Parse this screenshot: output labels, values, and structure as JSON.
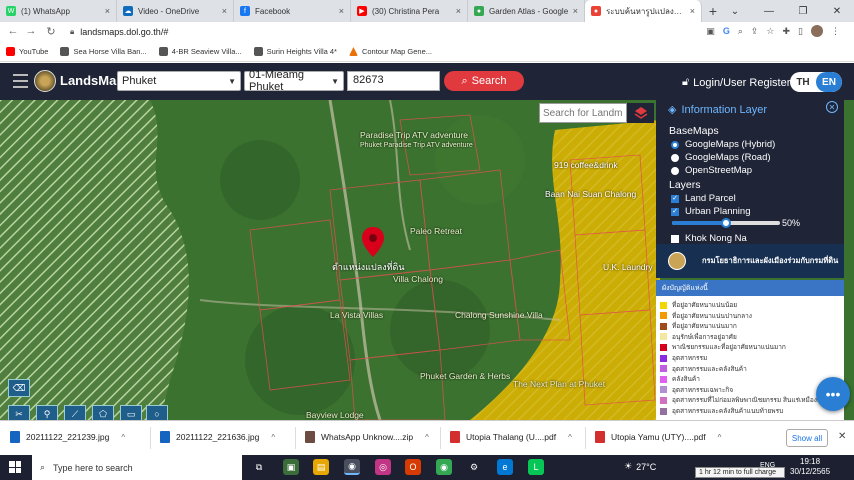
{
  "browser": {
    "tabs": [
      {
        "label": "(1) WhatsApp",
        "color": "#25d366",
        "glyph": "W"
      },
      {
        "label": "Video - OneDrive",
        "color": "#0f6cbd",
        "glyph": "☁"
      },
      {
        "label": "Facebook",
        "color": "#1877f2",
        "glyph": "f"
      },
      {
        "label": "(30) Christina Pera",
        "color": "#ff0000",
        "glyph": "▶"
      },
      {
        "label": "Garden Atlas - Google",
        "color": "#34a853",
        "glyph": "●"
      },
      {
        "label": "ระบบค้นหารูปแปลงที่ดิน",
        "color": "#ea4335",
        "glyph": "●"
      }
    ],
    "url": "landsmaps.dol.go.th/#",
    "bookmarks": [
      {
        "label": "YouTube",
        "color": "#ff0000"
      },
      {
        "label": "Sea Horse Villa Ban...",
        "color": "#555"
      },
      {
        "label": "4-BR Seaview Villa...",
        "color": "#555"
      },
      {
        "label": "Surin Heights Villa 4*",
        "color": "#555"
      },
      {
        "label": "Contour Map Gene...",
        "color": "#e8710a"
      }
    ]
  },
  "header": {
    "brand": "LandsMaps",
    "province": "Phuket",
    "district": "01-Mieamg Phuket",
    "parcel_no": "82673",
    "search_label": "Search",
    "login_label": "Login/User Register",
    "lang_th": "TH",
    "lang_en": "EN"
  },
  "map": {
    "search_placeholder": "Search for Landm",
    "pin_label": "ตำแหน่งแปลงที่ดิน",
    "labels": [
      "Paradise Trip ATV adventure",
      "Phuket Paradise Trip ATV adventure",
      "919 coffee&drink",
      "Baan Nai Suan Chalong",
      "Paleo Retreat",
      "Villa Chalong",
      "La Vista Villas",
      "Chalong Sunshine Villa",
      "Phuket Garden & Herbs",
      "The Next Plan at Phuket",
      "Bayview Lodge",
      "U.K. Laundry"
    ]
  },
  "info_panel": {
    "title": "Information Layer",
    "basemaps_label": "BaseMaps",
    "basemaps": [
      {
        "label": "GoogleMaps (Hybrid)",
        "selected": true
      },
      {
        "label": "GoogleMaps (Road)",
        "selected": false
      },
      {
        "label": "OpenStreetMap",
        "selected": false
      }
    ],
    "layers_label": "Layers",
    "layers": [
      {
        "label": "Land Parcel",
        "checked": true
      },
      {
        "label": "Urban Planning",
        "checked": true
      },
      {
        "label": "Khok Nong Na",
        "checked": false
      }
    ],
    "opacity_percent": 50,
    "opacity_label": "50%"
  },
  "dept_banner": "กรมโยธาธิการและผังเมืองร่วมกับกรมที่ดิน",
  "legend_header": "ผังบัญญัติแห่งนี้",
  "legend": [
    {
      "label": "ที่อยู่อาศัยหนาแน่นน้อย",
      "color": "#f2d600"
    },
    {
      "label": "ที่อยู่อาศัยหนาแน่นปานกลาง",
      "color": "#f29a00"
    },
    {
      "label": "ที่อยู่อาศัยหนาแน่นมาก",
      "color": "#a04a1a"
    },
    {
      "label": "อนุรักษ์เพื่อการอยู่อาศัย",
      "color": "#f4e7a0"
    },
    {
      "label": "พาณิชยกรรมและที่อยู่อาศัยหนาแน่นมาก",
      "color": "#d6001c"
    },
    {
      "label": "อุตสาหกรรม",
      "color": "#8a2be2"
    },
    {
      "label": "อุตสาหกรรมและคลังสินค้า",
      "color": "#c060e0"
    },
    {
      "label": "คลังสินค้า",
      "color": "#e060f0"
    },
    {
      "label": "อุตสาหกรรมเฉพาะกิจ",
      "color": "#b090d0"
    },
    {
      "label": "อุตสาหกรรมที่ไม่ก่อมลพิษพาณิชยกรรม สินแร่เหมืองแร่",
      "color": "#d070c0"
    },
    {
      "label": "อุตสาหกรรมและคลังสินค้าแนบท้ายพรบ",
      "color": "#9370a0"
    }
  ],
  "downloads": [
    {
      "label": "20211122_221239.jpg",
      "color": "#1565c0"
    },
    {
      "label": "20211122_221636.jpg",
      "color": "#1565c0"
    },
    {
      "label": "WhatsApp Unknow....zip",
      "color": "#6d4c41"
    },
    {
      "label": "Utopia Thalang (U....pdf",
      "color": "#d32f2f"
    },
    {
      "label": "Utopia Yamu (UTY)....pdf",
      "color": "#d32f2f"
    }
  ],
  "show_all_label": "Show all",
  "taskbar": {
    "search_placeholder": "Type here to search",
    "weather": "27°C",
    "time": "19:18",
    "date": "30/12/2565",
    "battery_tooltip": "1 hr 12 min to full charge",
    "lang": "ENG"
  }
}
